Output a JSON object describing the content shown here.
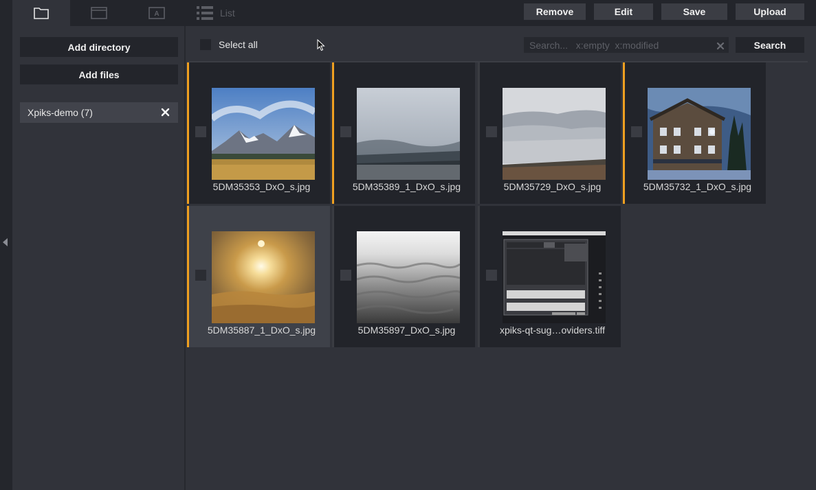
{
  "tabs": [
    {
      "icon": "folder-icon"
    },
    {
      "icon": "image-icon"
    },
    {
      "icon": "text-icon"
    },
    {
      "icon": "list-icon",
      "label": "List"
    }
  ],
  "actions": {
    "remove": "Remove",
    "edit": "Edit",
    "save": "Save",
    "upload": "Upload"
  },
  "sidebar": {
    "add_directory": "Add directory",
    "add_files": "Add files",
    "directories": [
      {
        "label": "Xpiks-demo (7)"
      }
    ]
  },
  "toolbar": {
    "select_all": "Select all",
    "search_placeholder": "Search...   x:empty  x:modified",
    "search_button": "Search"
  },
  "files": [
    {
      "name": "5DM35353_DxO_s.jpg",
      "modified": true,
      "selected": false
    },
    {
      "name": "5DM35389_1_DxO_s.jpg",
      "modified": true,
      "selected": false
    },
    {
      "name": "5DM35729_DxO_s.jpg",
      "modified": false,
      "selected": false
    },
    {
      "name": "5DM35732_1_DxO_s.jpg",
      "modified": true,
      "selected": false
    },
    {
      "name": "5DM35887_1_DxO_s.jpg",
      "modified": true,
      "selected": true
    },
    {
      "name": "5DM35897_DxO_s.jpg",
      "modified": false,
      "selected": false
    },
    {
      "name": "xpiks-qt-sug…oviders.tiff",
      "modified": false,
      "selected": false
    }
  ],
  "colors": {
    "accent_modified": "#f0a020",
    "background": "#31333a",
    "panel_dark": "#23252b"
  }
}
